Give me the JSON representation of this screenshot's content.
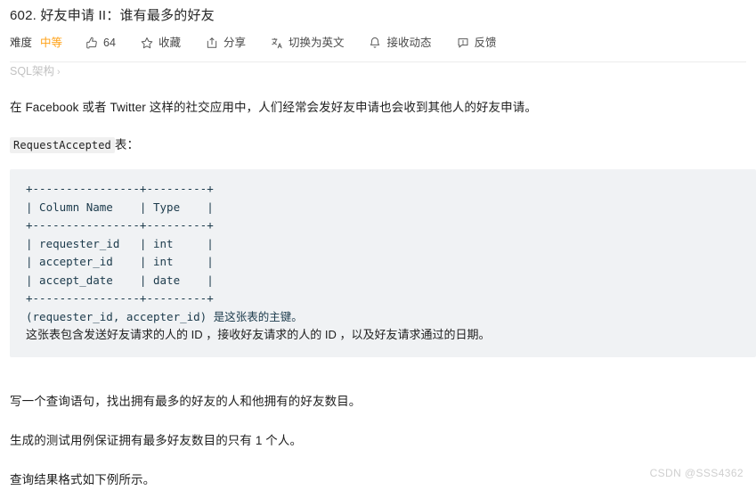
{
  "header": {
    "title": "602. 好友申请 II：谁有最多的好友"
  },
  "toolbar": {
    "difficulty_label": "难度",
    "difficulty_value": "中等",
    "difficulty_color": "#ffa116",
    "items": [
      {
        "icon": "thumbs-up-icon",
        "label": "64"
      },
      {
        "icon": "star-icon",
        "label": "收藏"
      },
      {
        "icon": "share-icon",
        "label": "分享"
      },
      {
        "icon": "translate-icon",
        "label": "切换为英文"
      },
      {
        "icon": "bell-icon",
        "label": "接收动态"
      },
      {
        "icon": "feedback-icon",
        "label": "反馈"
      }
    ]
  },
  "breadcrumb": {
    "label": "SQL架构",
    "caret": "›"
  },
  "body": {
    "intro": "在 Facebook 或者 Twitter 这样的社交应用中，人们经常会发好友申请也会收到其他人的好友申请。",
    "table_label_code": "RequestAccepted",
    "table_label_suffix": "表：",
    "code_block": "+----------------+---------+\n| Column Name    | Type    |\n+----------------+---------+\n| requester_id   | int     |\n| accepter_id    | int     |\n| accept_date    | date    |\n+----------------+---------+",
    "code_note_1": "(requester_id, accepter_id) 是这张表的主键。",
    "code_note_2": "这张表包含发送好友请求的人的 ID ，接收好友请求的人的 ID ，以及好友请求通过的日期。",
    "tail_paragraphs": [
      "写一个查询语句，找出拥有最多的好友的人和他拥有的好友数目。",
      "生成的测试用例保证拥有最多好友数目的只有 1 个人。",
      "查询结果格式如下例所示。"
    ]
  },
  "watermark": {
    "text": "CSDN @SSS4362"
  }
}
